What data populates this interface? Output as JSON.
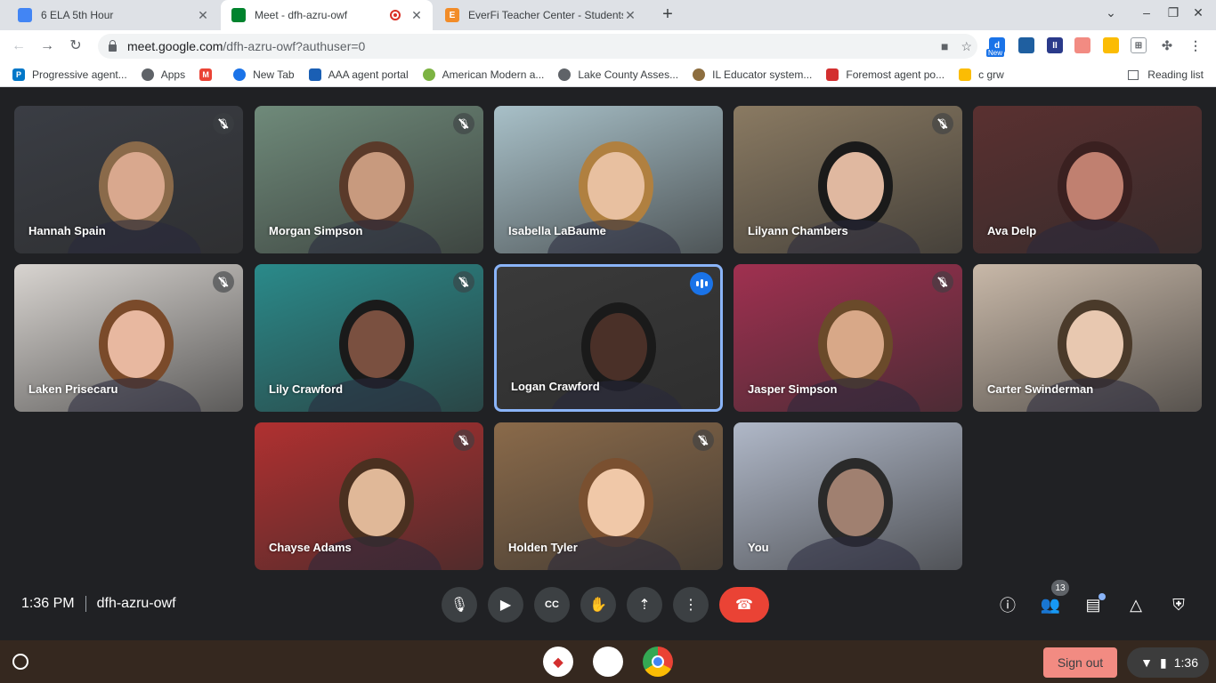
{
  "tabs": [
    {
      "title": "6 ELA 5th Hour",
      "icon": "classroom-icon",
      "color": "#4285f4"
    },
    {
      "title": "Meet - dfh-azru-owf",
      "icon": "meet-icon",
      "color": "#00832d"
    },
    {
      "title": "EverFi Teacher Center - Students",
      "icon": "everfi-icon",
      "color": "#f28c28"
    }
  ],
  "omnibox": {
    "host": "meet.google.com",
    "path": "/dfh-azru-owf?authuser=0"
  },
  "extensions": {
    "new_label": "New"
  },
  "bookmarks": [
    {
      "label": "Progressive agent...",
      "color": "#0077c8"
    },
    {
      "label": "Apps",
      "color": "#5f6368"
    },
    {
      "label": "",
      "color": "#ea4335"
    },
    {
      "label": "New Tab",
      "color": "#1a73e8"
    },
    {
      "label": "AAA agent portal",
      "color": "#1a5fb4"
    },
    {
      "label": "American Modern a...",
      "color": "#7cb342"
    },
    {
      "label": "Lake County Asses...",
      "color": "#5f6368"
    },
    {
      "label": "IL Educator system...",
      "color": "#8d6e3f"
    },
    {
      "label": "Foremost agent po...",
      "color": "#d32f2f"
    },
    {
      "label": "c grw",
      "color": "#fbbc04"
    }
  ],
  "reading_list": "Reading list",
  "participants": [
    {
      "name": "Hannah Spain",
      "muted": true,
      "bg": "#3a3d44",
      "skin": "#d9a88e",
      "hair": "#8a6a4a"
    },
    {
      "name": "Morgan Simpson",
      "muted": true,
      "bg": "#6f8a7a",
      "skin": "#c89a7e",
      "hair": "#5a3a2a"
    },
    {
      "name": "Isabella LaBaume",
      "muted": false,
      "bg": "#a8c0c8",
      "skin": "#e8c0a0",
      "hair": "#b08040"
    },
    {
      "name": "Lilyann Chambers",
      "muted": true,
      "bg": "#8a7a62",
      "skin": "#e0b8a0",
      "hair": "#1a1a1a"
    },
    {
      "name": "Ava Delp",
      "muted": false,
      "bg": "#5a3030",
      "skin": "#c08070",
      "hair": "#3a2020"
    },
    {
      "name": "Laken Prisecaru",
      "muted": true,
      "bg": "#d8d4d0",
      "skin": "#e8b8a0",
      "hair": "#7a4a2a"
    },
    {
      "name": "Lily Crawford",
      "muted": true,
      "bg": "#2a8a8a",
      "skin": "#7a5040",
      "hair": "#1a1a1a"
    },
    {
      "name": "Logan Crawford",
      "muted": false,
      "bg": "#3a3a3a",
      "skin": "#4a3028",
      "hair": "#1a1a1a"
    },
    {
      "name": "Jasper Simpson",
      "muted": true,
      "bg": "#a03050",
      "skin": "#d8a888",
      "hair": "#6a4a2a"
    },
    {
      "name": "Carter Swinderman",
      "muted": false,
      "bg": "#c8b8a8",
      "skin": "#e8c8b0",
      "hair": "#4a3a2a"
    },
    {
      "name": "Chayse Adams",
      "muted": true,
      "bg": "#b03030",
      "skin": "#e0b898",
      "hair": "#4a3020"
    },
    {
      "name": "Holden Tyler",
      "muted": true,
      "bg": "#8a6a4a",
      "skin": "#f0c8a8",
      "hair": "#7a5030"
    },
    {
      "name": "You",
      "muted": false,
      "bg": "#b0b8c8",
      "skin": "#a08070",
      "hair": "#2a2a2a"
    }
  ],
  "meeting": {
    "time": "1:36 PM",
    "code": "dfh-azru-owf",
    "people_count": "13"
  },
  "shelf": {
    "sign_out": "Sign out",
    "clock": "1:36"
  }
}
